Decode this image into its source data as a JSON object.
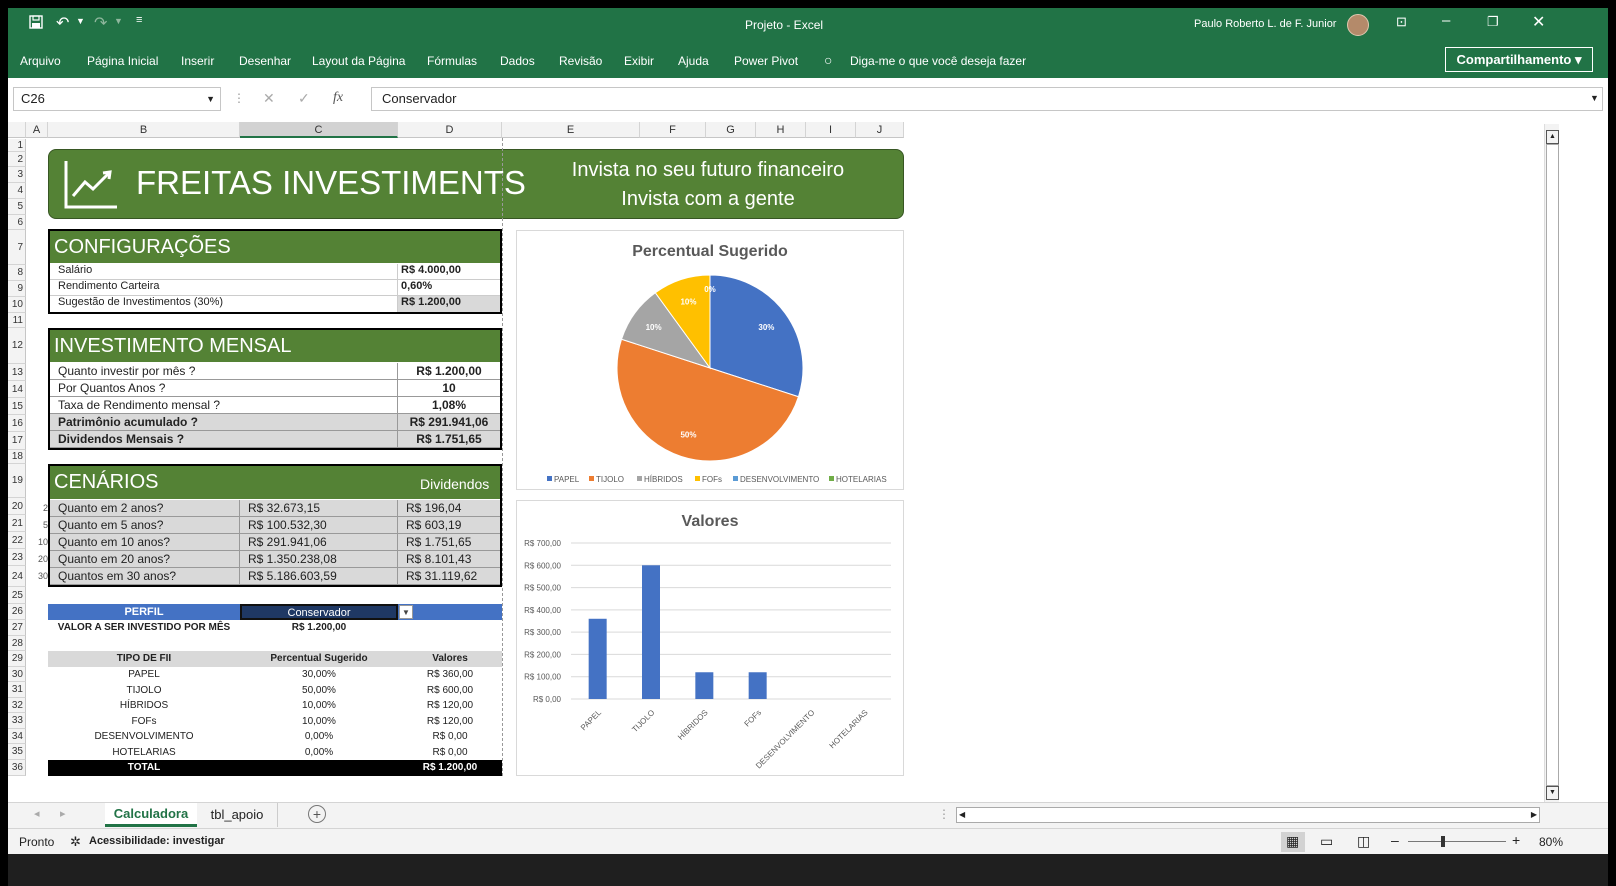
{
  "window": {
    "title": "Projeto  -  Excel",
    "user": "Paulo Roberto L. de F. Junior"
  },
  "ribbon": {
    "menus": [
      "Arquivo",
      "Página Inicial",
      "Inserir",
      "Desenhar",
      "Layout da Página",
      "Fórmulas",
      "Dados",
      "Revisão",
      "Exibir",
      "Ajuda",
      "Power Pivot"
    ],
    "tell_me": "Diga-me o que você deseja fazer",
    "share": "Compartilhamento"
  },
  "formula_bar": {
    "name_box": "C26",
    "value": "Conservador",
    "fx": "fx"
  },
  "columns": [
    "A",
    "B",
    "C",
    "D",
    "E",
    "F",
    "G",
    "H",
    "I",
    "J"
  ],
  "rows": [
    "1",
    "2",
    "3",
    "4",
    "5",
    "6",
    "7",
    "8",
    "9",
    "10",
    "11",
    "12",
    "13",
    "14",
    "15",
    "16",
    "17",
    "18",
    "19",
    "20",
    "21",
    "22",
    "23",
    "24",
    "25",
    "26",
    "27",
    "28",
    "29",
    "30",
    "31",
    "32",
    "33",
    "34",
    "35",
    "36"
  ],
  "banner": {
    "title": "FREITAS INVESTIMENTS",
    "tagline1": "Invista no seu futuro financeiro",
    "tagline2": "Invista com a gente"
  },
  "config": {
    "header": "CONFIGURAÇÕES",
    "rows": [
      {
        "label": "Salário",
        "value": "R$ 4.000,00"
      },
      {
        "label": "Rendimento Carteira",
        "value": "0,60%"
      },
      {
        "label": "Sugestão de Investimentos (30%)",
        "value": "R$ 1.200,00"
      }
    ]
  },
  "investimento": {
    "header": "INVESTIMENTO MENSAL",
    "rows": [
      {
        "label": "Quanto investir por mês ?",
        "value": "R$ 1.200,00"
      },
      {
        "label": "Por Quantos Anos ?",
        "value": "10"
      },
      {
        "label": "Taxa de Rendimento mensal ?",
        "value": "1,08%"
      },
      {
        "label": "Patrimônio acumulado ?",
        "value": "R$ 291.941,06"
      },
      {
        "label": "Dividendos Mensais ?",
        "value": "R$ 1.751,65"
      }
    ]
  },
  "cenarios": {
    "header": "CENÁRIOS",
    "dividendos_label": "Dividendos",
    "rows": [
      {
        "n": "2",
        "label": "Quanto em 2 anos?",
        "value": "R$ 32.673,15",
        "div": "R$ 196,04"
      },
      {
        "n": "5",
        "label": "Quanto em 5 anos?",
        "value": "R$ 100.532,30",
        "div": "R$ 603,19"
      },
      {
        "n": "10",
        "label": "Quanto em 10 anos?",
        "value": "R$ 291.941,06",
        "div": "R$ 1.751,65"
      },
      {
        "n": "20",
        "label": "Quanto em 20 anos?",
        "value": "R$ 1.350.238,08",
        "div": "R$ 8.101,43"
      },
      {
        "n": "30",
        "label": "Quantos em 30 anos?",
        "value": "R$ 5.186.603,59",
        "div": "R$ 31.119,62"
      }
    ]
  },
  "perfil": {
    "label": "PERFIL",
    "value": "Conservador",
    "valor_label": "VALOR A SER INVESTIDO POR MÊS",
    "valor": "R$ 1.200,00"
  },
  "fii_table": {
    "headers": [
      "TIPO DE FII",
      "Percentual Sugerido",
      "Valores"
    ],
    "rows": [
      {
        "tipo": "PAPEL",
        "pct": "30,00%",
        "valor": "R$ 360,00"
      },
      {
        "tipo": "TIJOLO",
        "pct": "50,00%",
        "valor": "R$ 600,00"
      },
      {
        "tipo": "HÍBRIDOS",
        "pct": "10,00%",
        "valor": "R$ 120,00"
      },
      {
        "tipo": "FOFs",
        "pct": "10,00%",
        "valor": "R$ 120,00"
      },
      {
        "tipo": "DESENVOLVIMENTO",
        "pct": "0,00%",
        "valor": "R$ 0,00"
      },
      {
        "tipo": "HOTELARIAS",
        "pct": "0,00%",
        "valor": "R$ 0,00"
      }
    ],
    "total_label": "TOTAL",
    "total": "R$ 1.200,00"
  },
  "chart_data": [
    {
      "type": "pie",
      "title": "Percentual Sugerido",
      "categories": [
        "PAPEL",
        "TIJOLO",
        "HÍBRIDOS",
        "FOFs",
        "DESENVOLVIMENTO",
        "HOTELARIAS"
      ],
      "values": [
        30,
        50,
        10,
        10,
        0,
        0
      ],
      "data_labels": [
        "30%",
        "50%",
        "10%",
        "10%",
        "0%",
        "0%"
      ],
      "colors": [
        "#4472c4",
        "#ed7d31",
        "#a5a5a5",
        "#ffc000",
        "#5b9bd5",
        "#70ad47"
      ],
      "legend": "bottom"
    },
    {
      "type": "bar",
      "title": "Valores",
      "categories": [
        "PAPEL",
        "TIJOLO",
        "HÍBRIDOS",
        "FOFs",
        "DESENVOLVIMENTO",
        "HOTELARIAS"
      ],
      "values": [
        360,
        600,
        120,
        120,
        0,
        0
      ],
      "ylim": [
        0,
        700
      ],
      "yticks": [
        "R$ 0,00",
        "R$ 100,00",
        "R$ 200,00",
        "R$ 300,00",
        "R$ 400,00",
        "R$ 500,00",
        "R$ 600,00",
        "R$ 700,00"
      ],
      "color": "#4472c4",
      "grid": true
    }
  ],
  "sheets": {
    "tabs": [
      "Calculadora",
      "tbl_apoio"
    ],
    "active": "Calculadora"
  },
  "status": {
    "ready": "Pronto",
    "accessibility": "Acessibilidade: investigar",
    "zoom": "80%"
  }
}
